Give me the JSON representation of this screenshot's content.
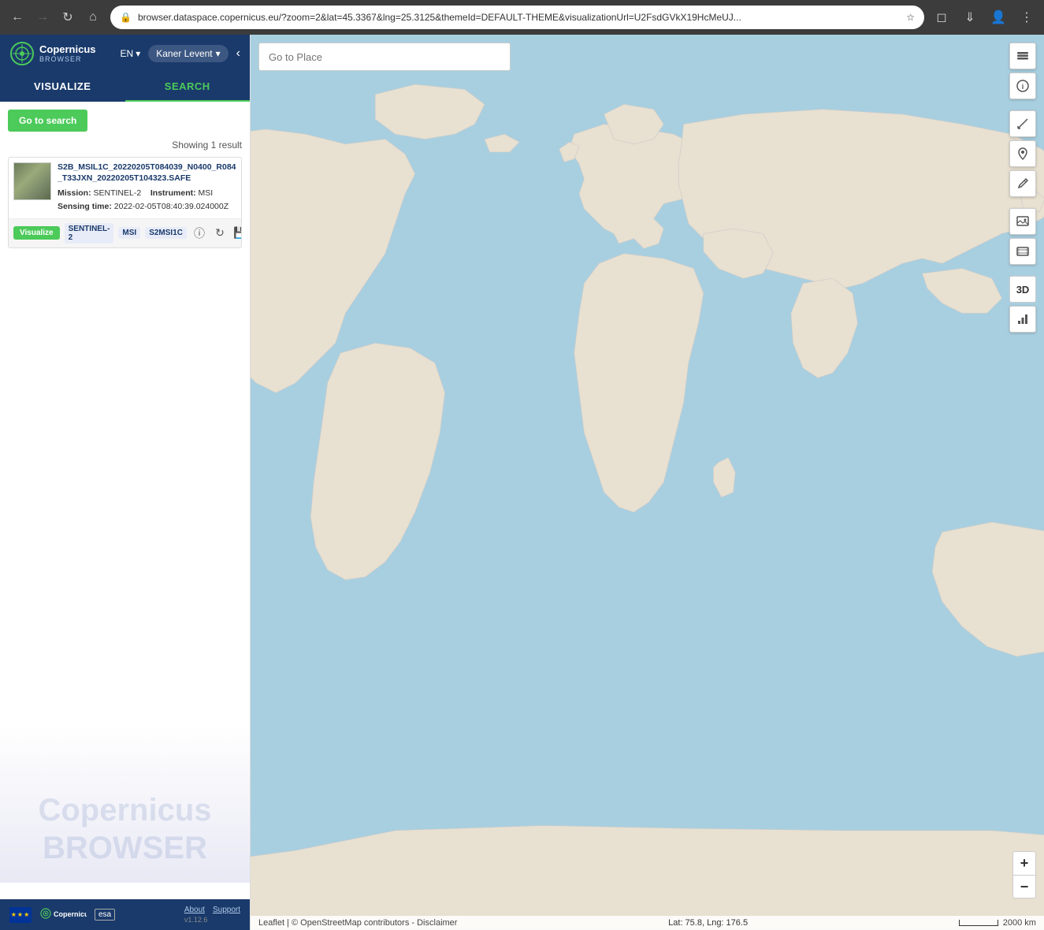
{
  "browser": {
    "url": "browser.dataspace.copernicus.eu/?zoom=2&lat=45.3367&lng=25.3125&themeId=DEFAULT-THEME&visualizationUrl=U2FsdGVkX19HcMeUJ...",
    "back_disabled": false,
    "forward_disabled": true,
    "reload_label": "↻",
    "home_label": "⌂"
  },
  "sidebar": {
    "logo_text": "Copernicus",
    "logo_sub": "BROWSER",
    "lang": "EN",
    "lang_arrow": "▾",
    "user": "Kaner Levent",
    "user_arrow": "▾",
    "back_label": "‹",
    "tab_visualize": "VISUALIZE",
    "tab_search": "SEARCH",
    "go_to_search_label": "Go to search",
    "results_info": "Showing 1 result",
    "result": {
      "title": "S2B_MSIL1C_20220205T084039_N0400_R084_T33JXN_20220205T104323.SAFE",
      "mission_label": "Mission:",
      "mission_value": "SENTINEL-2",
      "instrument_label": "Instrument:",
      "instrument_value": "MSI",
      "sensing_label": "Sensing time:",
      "sensing_value": "2022-02-05T08:40:39.024000Z",
      "visualize_btn": "Visualize",
      "tag1": "SENTINEL-2",
      "tag2": "MSI",
      "tag3": "S2MSI1C"
    },
    "footer": {
      "about_label": "About",
      "support_label": "Support",
      "version": "v1.12.6"
    }
  },
  "map": {
    "search_placeholder": "Go to Place",
    "coords": "Lat: 75.8, Lng: 176.5",
    "scale_label": "2000 km",
    "attribution": "Leaflet | © OpenStreetMap contributors - Disclaimer",
    "zoom_in": "+",
    "zoom_out": "−"
  },
  "toolbar": {
    "layers_icon": "layers",
    "info_icon": "info",
    "measure_icon": "ruler",
    "location_icon": "location",
    "draw_icon": "pencil",
    "image_icon": "image",
    "film_icon": "film",
    "chart_icon": "chart",
    "btn_3d": "3D"
  }
}
